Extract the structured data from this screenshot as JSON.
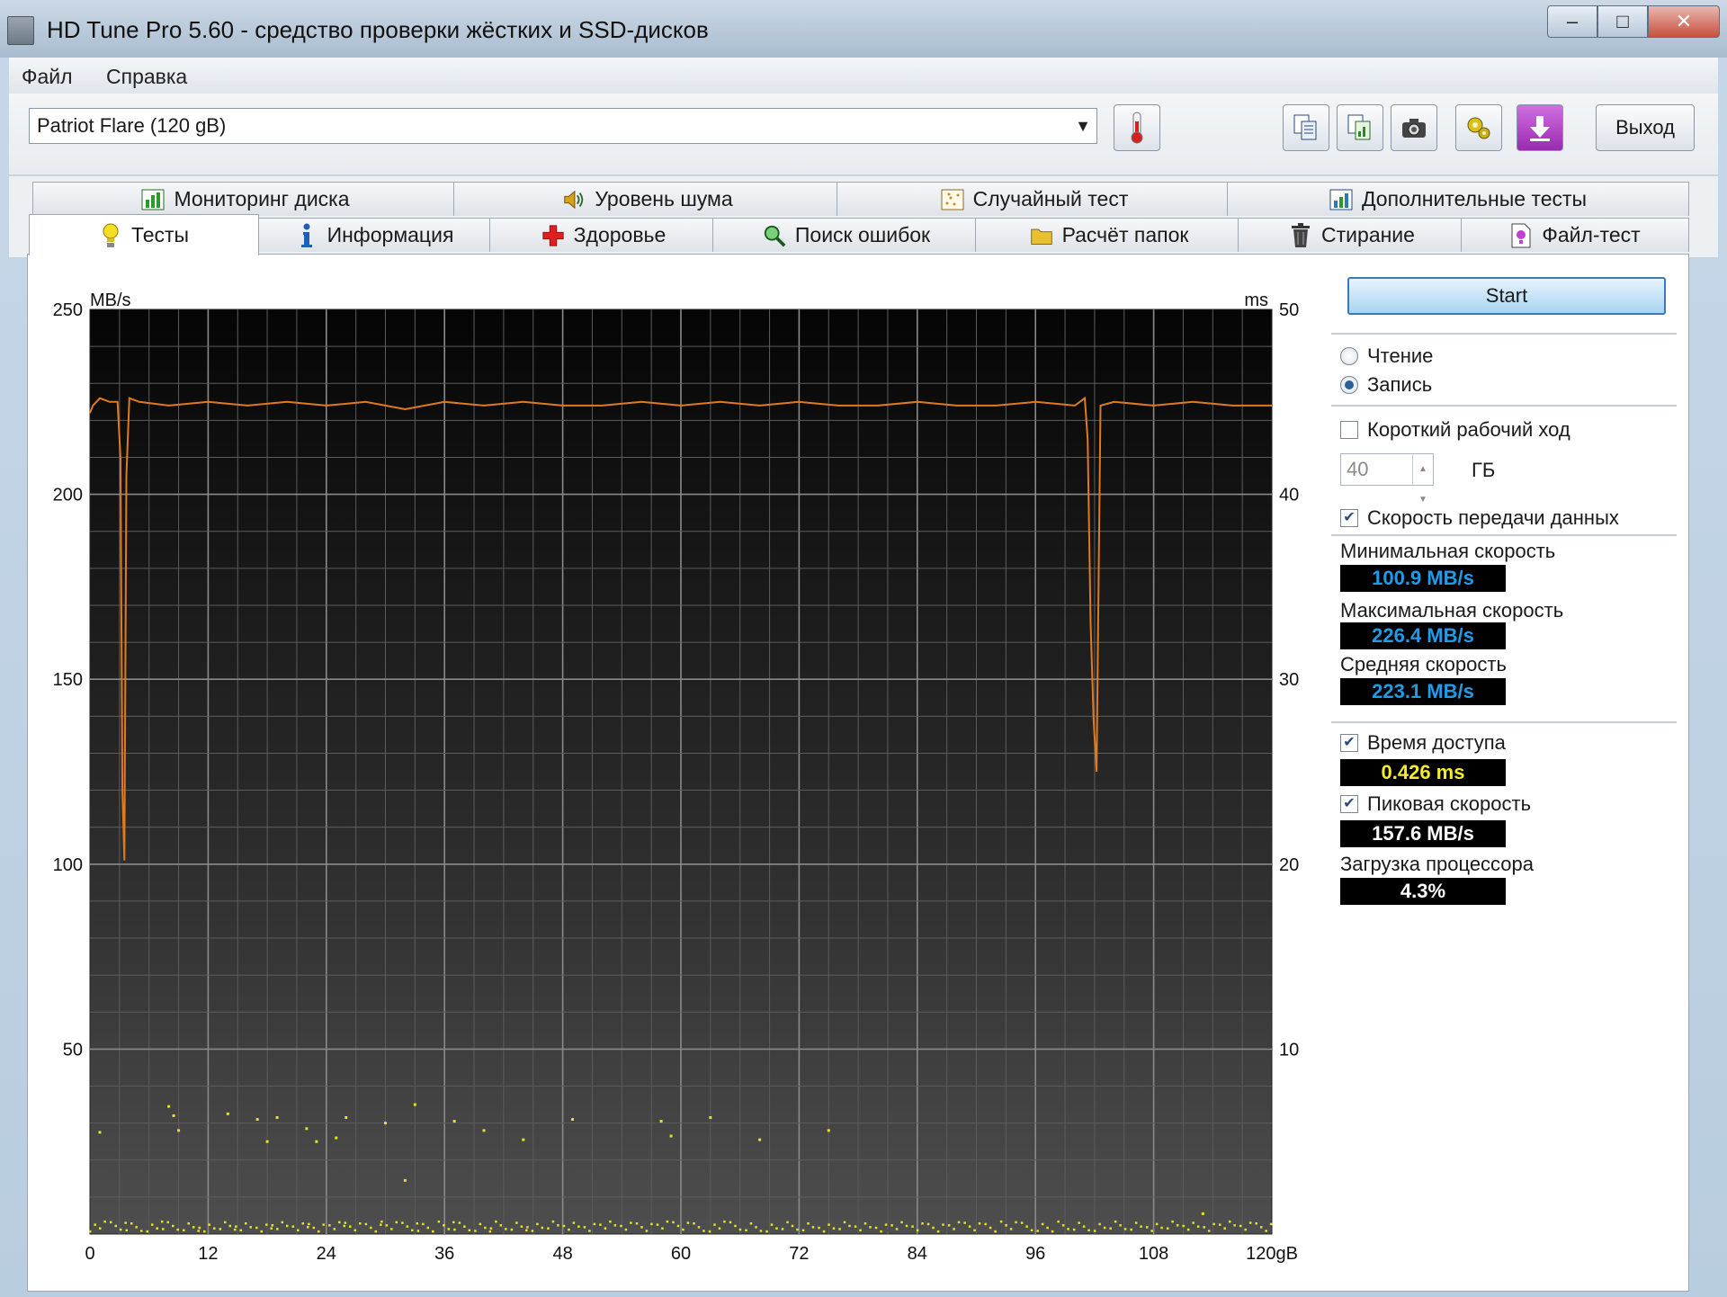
{
  "window": {
    "title": "HD Tune Pro 5.60 - средство проверки жёстких и SSD-дисков",
    "caption_min": "‒",
    "caption_max": "□",
    "caption_close": "✕"
  },
  "menu": {
    "file": "Файл",
    "help": "Справка"
  },
  "toolbar": {
    "drive": "Patriot Flare (120 gB)",
    "exit_label": "Выход",
    "icons": [
      "thermometer-icon",
      "copy-text-icon",
      "copy-info-icon",
      "camera-icon",
      "options-icon",
      "save-download-icon"
    ]
  },
  "tabs_top": [
    {
      "label": "Мониторинг диска",
      "icon": "monitor-chart-icon"
    },
    {
      "label": "Уровень шума",
      "icon": "speaker-icon"
    },
    {
      "label": "Случайный тест",
      "icon": "random-icon"
    },
    {
      "label": "Дополнительные тесты",
      "icon": "extra-tests-icon"
    }
  ],
  "tabs_bottom": [
    {
      "label": "Тесты",
      "icon": "lightbulb-icon",
      "active": true
    },
    {
      "label": "Информация",
      "icon": "info-icon"
    },
    {
      "label": "Здоровье",
      "icon": "health-cross-icon"
    },
    {
      "label": "Поиск ошибок",
      "icon": "magnifier-icon"
    },
    {
      "label": "Расчёт папок",
      "icon": "folder-icon"
    },
    {
      "label": "Стирание",
      "icon": "trash-icon"
    },
    {
      "label": "Файл-тест",
      "icon": "file-test-icon"
    }
  ],
  "controls": {
    "start_label": "Start",
    "read_label": "Чтение",
    "write_label": "Запись",
    "mode_selected": "write",
    "short_stroke_label": "Короткий рабочий ход",
    "short_stroke_checked": false,
    "short_stroke_value": "40",
    "short_stroke_unit": "ГБ",
    "transfer_rate_label": "Скорость передачи данных",
    "transfer_rate_checked": true,
    "min_label": "Минимальная скорость",
    "min_value": "100.9 MB/s",
    "max_label": "Максимальная скорость",
    "max_value": "226.4 MB/s",
    "avg_label": "Средняя скорость",
    "avg_value": "223.1 MB/s",
    "access_label": "Время доступа",
    "access_checked": true,
    "access_value": "0.426 ms",
    "burst_label": "Пиковая скорость",
    "burst_checked": true,
    "burst_value": "157.6 MB/s",
    "cpu_label": "Загрузка процессора",
    "cpu_value": "4.3%",
    "colors": {
      "speed_value": "#1e9ce8",
      "access_value": "#f2ec2a",
      "plain_value": "#ffffff"
    }
  },
  "chart_data": {
    "type": "line",
    "y_left_unit": "MB/s",
    "y_right_unit": "ms",
    "x_ticks": [
      "0",
      "12",
      "24",
      "36",
      "48",
      "60",
      "72",
      "84",
      "96",
      "108",
      "120gB"
    ],
    "y_left_ticks": [
      "250",
      "200",
      "150",
      "100",
      "50"
    ],
    "y_right_ticks": [
      "50",
      "40",
      "30",
      "20",
      "10"
    ],
    "xlim": [
      0,
      120
    ],
    "ylim_left": [
      0,
      250
    ],
    "ylim_right": [
      0,
      50
    ],
    "grid": true,
    "series": [
      {
        "kind": "transfer-line",
        "color": "#e07a1e",
        "x": [
          0,
          0.3,
          1.0,
          2.0,
          2.8,
          3.1,
          3.2,
          3.3,
          3.5,
          3.7,
          4.0,
          5,
          8,
          12,
          16,
          20,
          24,
          28,
          32,
          36,
          40,
          44,
          48,
          52,
          56,
          60,
          64,
          68,
          72,
          76,
          80,
          84,
          88,
          92,
          96,
          100,
          101.0,
          101.3,
          101.6,
          101.9,
          102.2,
          102.6,
          104,
          108,
          112,
          116,
          120
        ],
        "y": [
          222,
          224,
          226,
          225,
          225,
          210,
          165,
          120,
          101,
          205,
          226,
          225,
          224,
          225,
          224,
          225,
          224,
          225,
          223,
          225,
          224,
          225,
          224,
          224,
          225,
          224,
          225,
          224,
          225,
          224,
          224,
          225,
          224,
          224,
          225,
          224,
          226,
          215,
          165,
          139,
          125,
          224,
          225,
          224,
          225,
          224,
          224
        ]
      },
      {
        "kind": "access-time-points",
        "color": "#e6e22a",
        "x": [
          1,
          8,
          8.5,
          9,
          14,
          17,
          18,
          19,
          22,
          23,
          25,
          26,
          30,
          32,
          33,
          37,
          40,
          44,
          49,
          58,
          59,
          63,
          68,
          75,
          113
        ],
        "y": [
          5.5,
          6.9,
          6.4,
          5.6,
          6.5,
          6.2,
          5.0,
          6.3,
          5.7,
          5.0,
          5.2,
          6.3,
          6.0,
          2.9,
          7.0,
          6.1,
          5.6,
          5.1,
          6.2,
          6.1,
          5.3,
          6.3,
          5.1,
          5.6,
          1.1
        ]
      }
    ]
  }
}
